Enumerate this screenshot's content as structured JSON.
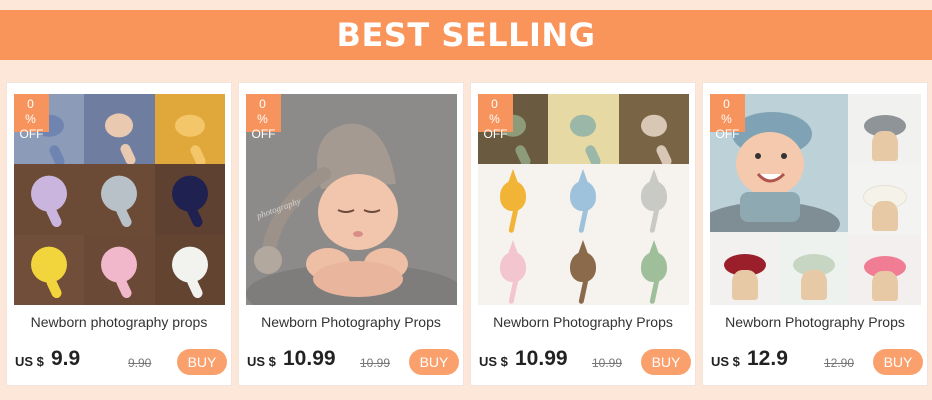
{
  "banner": {
    "title": "BEST SELLING"
  },
  "products": [
    {
      "badge_line1": "0 %",
      "badge_line2": "OFF",
      "title": "Newborn photography props",
      "currency": "US $",
      "price": "9.9",
      "old_price": "9.90",
      "buy_label": "BUY"
    },
    {
      "badge_line1": "0 %",
      "badge_line2": "OFF",
      "title": "Newborn Photography Props",
      "currency": "US $",
      "price": "10.99",
      "old_price": "10.99",
      "buy_label": "BUY"
    },
    {
      "badge_line1": "0 %",
      "badge_line2": "OFF",
      "title": "Newborn Photography Props",
      "currency": "US $",
      "price": "10.99",
      "old_price": "10.99",
      "buy_label": "BUY"
    },
    {
      "badge_line1": "0 %",
      "badge_line2": "OFF",
      "title": "Newborn Photography Props",
      "currency": "US $",
      "price": "12.9",
      "old_price": "12.90",
      "buy_label": "BUY"
    }
  ],
  "colors": {
    "page_background": "#fde7d8",
    "banner_background": "#f9955a",
    "badge": "#f7945d",
    "buy_button": "#f9a06c"
  }
}
